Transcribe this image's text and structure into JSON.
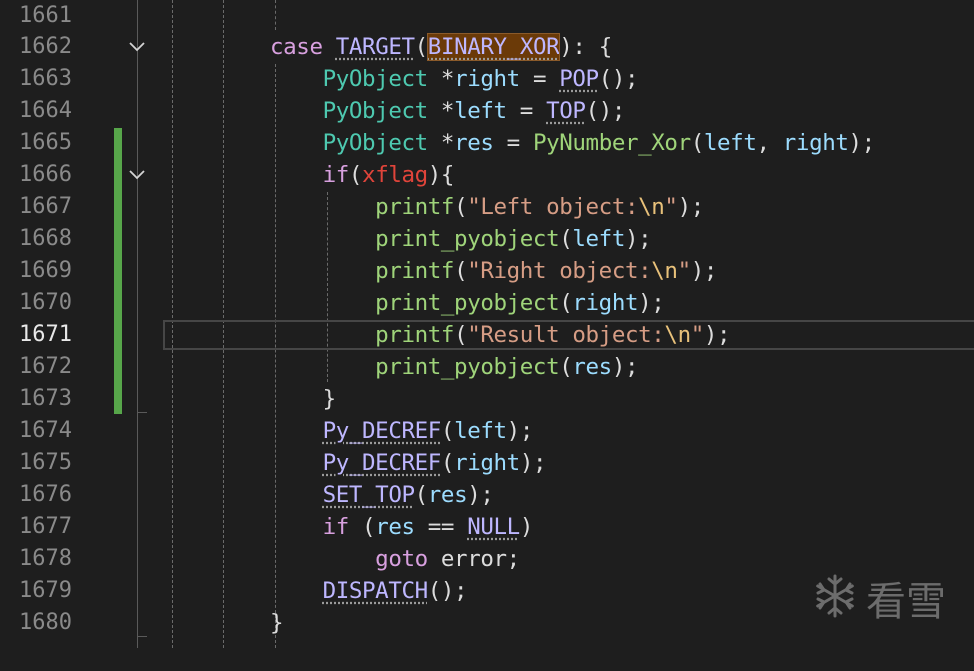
{
  "editor": {
    "current_line": "1671",
    "lines": [
      {
        "n": "1661",
        "t": ""
      },
      {
        "n": "1662",
        "t": "case TARGET(BINARY_XOR): {"
      },
      {
        "n": "1663",
        "t": "    PyObject *right = POP();"
      },
      {
        "n": "1664",
        "t": "    PyObject *left = TOP();"
      },
      {
        "n": "1665",
        "t": "    PyObject *res = PyNumber_Xor(left, right);"
      },
      {
        "n": "1666",
        "t": "    if(xflag){"
      },
      {
        "n": "1667",
        "t": "        printf(\"Left object:\\n\");"
      },
      {
        "n": "1668",
        "t": "        print_pyobject(left);"
      },
      {
        "n": "1669",
        "t": "        printf(\"Right object:\\n\");"
      },
      {
        "n": "1670",
        "t": "        print_pyobject(right);"
      },
      {
        "n": "1671",
        "t": "        printf(\"Result object:\\n\");"
      },
      {
        "n": "1672",
        "t": "        print_pyobject(res);"
      },
      {
        "n": "1673",
        "t": "    }"
      },
      {
        "n": "1674",
        "t": "    Py_DECREF(left);"
      },
      {
        "n": "1675",
        "t": "    Py_DECREF(right);"
      },
      {
        "n": "1676",
        "t": "    SET_TOP(res);"
      },
      {
        "n": "1677",
        "t": "    if (res == NULL)"
      },
      {
        "n": "1678",
        "t": "        goto error;"
      },
      {
        "n": "1679",
        "t": "    DISPATCH();"
      },
      {
        "n": "1680",
        "t": "}"
      }
    ],
    "fold_lines": [
      "1662",
      "1666"
    ],
    "colors": {
      "background": "#1e1e1e",
      "change_bar": "#57a64a",
      "keyword": "#d8a0df",
      "macro": "#beb7ff",
      "type": "#4ec9b0",
      "function": "#b5cea8",
      "variable": "#9cdcfe",
      "string": "#d69d85",
      "highlight": "#6b3a08"
    }
  },
  "watermark": {
    "icon": "snowflake-icon",
    "text": "看雪"
  }
}
